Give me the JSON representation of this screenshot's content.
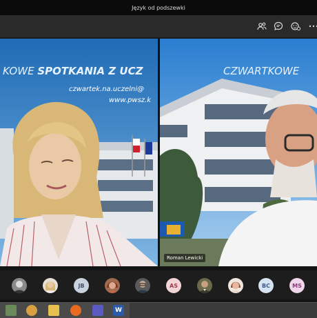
{
  "window": {
    "title": "Język od podszewki"
  },
  "toolbar": {
    "icons": [
      "participants-icon",
      "chat-icon",
      "reactions-icon",
      "more-icon"
    ]
  },
  "tiles": [
    {
      "banner_title": "KOWE SPOTKANIA Z UCZ",
      "banner_title_bold": "SPOTKANIA Z UCZ",
      "banner_email": "czwartek.na.uczelni@",
      "banner_web": "www.pwsz.k",
      "participant_name": ""
    },
    {
      "banner_title": "CZWARTKOWE",
      "participant_name": "Roman Lewicki"
    }
  ],
  "roster": [
    {
      "initials": "",
      "kind": "photo",
      "color": "#8a8a8a"
    },
    {
      "initials": "",
      "kind": "photo",
      "color": "#b59a6a"
    },
    {
      "initials": "JB",
      "kind": "initials",
      "color": "#c9d3dd",
      "text": "#44536a"
    },
    {
      "initials": "",
      "kind": "photo",
      "color": "#a06a50"
    },
    {
      "initials": "",
      "kind": "photo",
      "color": "#5a5a5a"
    },
    {
      "initials": "AS",
      "kind": "initials",
      "color": "#f2d3d6",
      "text": "#9a3a4a"
    },
    {
      "initials": "",
      "kind": "photo",
      "color": "#6a6a4a"
    },
    {
      "initials": "",
      "kind": "photo",
      "color": "#c08a6a"
    },
    {
      "initials": "BC",
      "kind": "initials",
      "color": "#d6e4f2",
      "text": "#3a5a8a"
    },
    {
      "initials": "MS",
      "kind": "initials",
      "color": "#f0d6ea",
      "text": "#8a3a7a"
    }
  ],
  "taskbar": {
    "icons": [
      "windows-app-icon",
      "firefox-like-icon",
      "folder-icon",
      "firefox-icon",
      "teams-icon",
      "word-icon"
    ]
  }
}
